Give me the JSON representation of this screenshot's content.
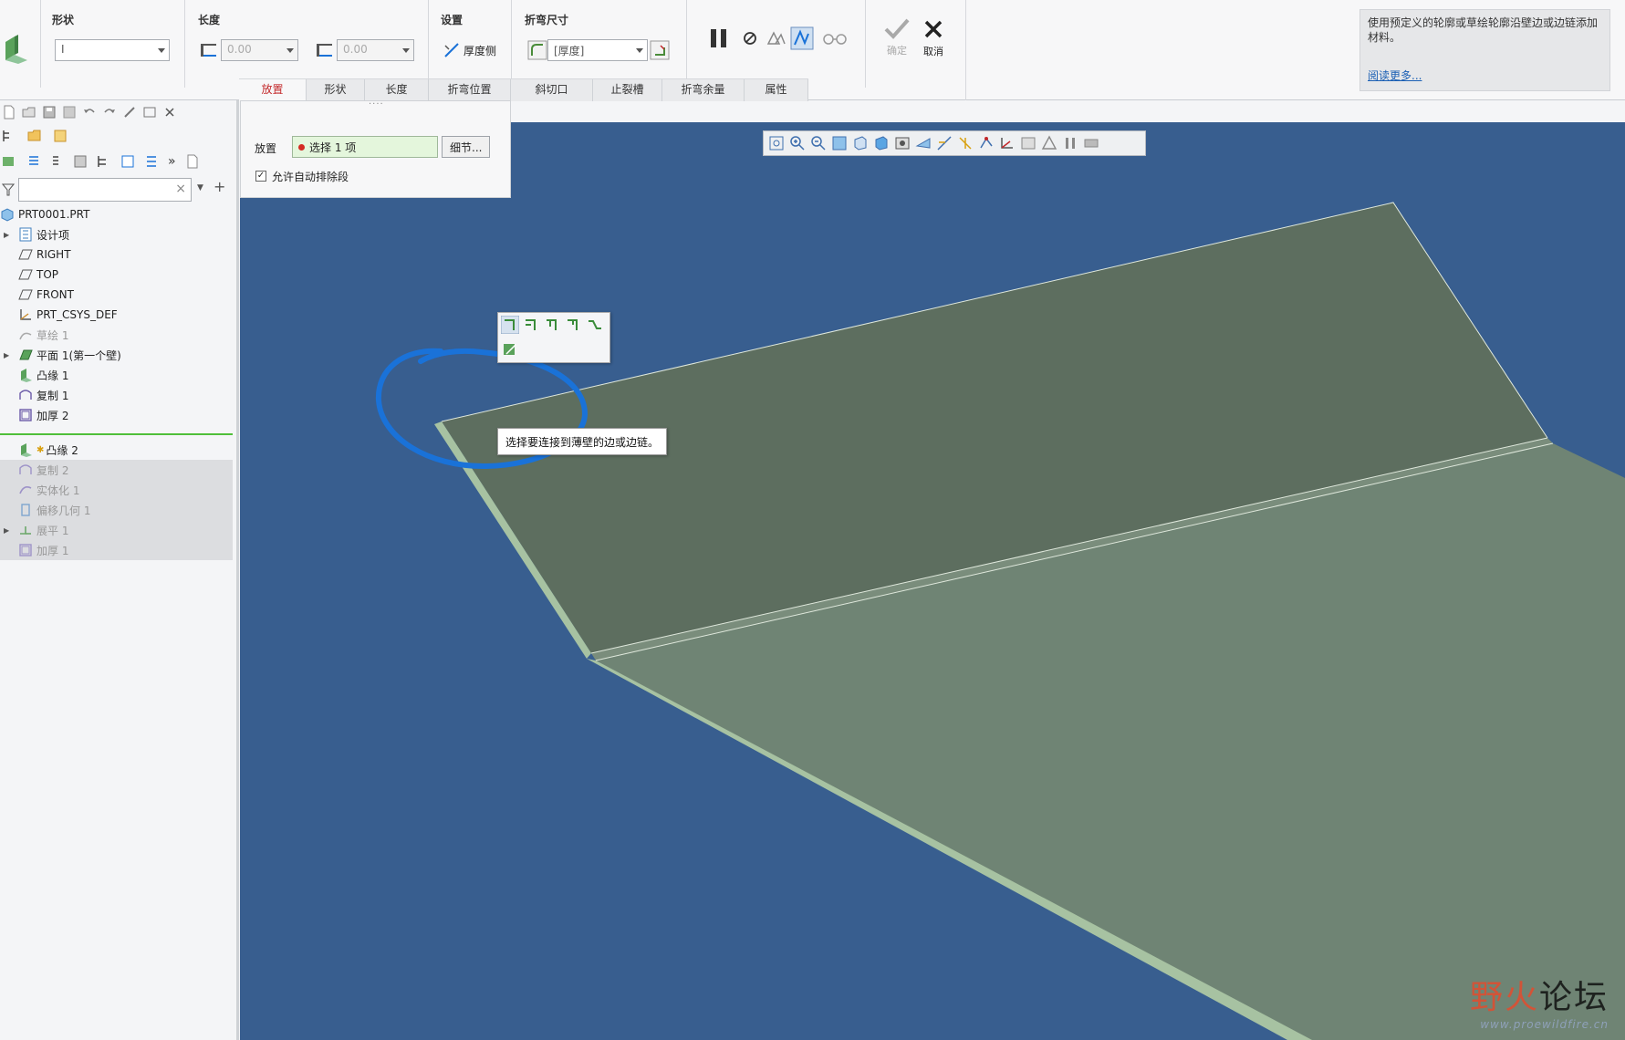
{
  "dashboard": {
    "shape_label": "形状",
    "shape_value": "I",
    "length_label": "长度",
    "length_value1": "0.00",
    "length_value2": "0.00",
    "settings_label": "设置",
    "thickness_side_label": "厚度侧",
    "bend_dim_label": "折弯尺寸",
    "bend_dim_value": "[厚度]",
    "ok_label": "确定",
    "cancel_label": "取消",
    "tabs": [
      "放置",
      "形状",
      "长度",
      "折弯位置",
      "斜切口",
      "止裂槽",
      "折弯余量",
      "属性"
    ],
    "help_text": "使用预定义的轮廓或草绘轮廓沿壁边或边链添加材料。",
    "help_link": "阅读更多..."
  },
  "placement": {
    "label": "放置",
    "selection": "选择 1 项",
    "details_button": "细节...",
    "auto_exclude_label": "允许自动排除段",
    "auto_exclude_checked": true
  },
  "tree": {
    "items": [
      {
        "label": "PRT0001.PRT",
        "icon": "part-icon"
      },
      {
        "label": "设计项",
        "icon": "design-items-icon"
      },
      {
        "label": "RIGHT",
        "icon": "datum-plane-icon"
      },
      {
        "label": "TOP",
        "icon": "datum-plane-icon"
      },
      {
        "label": "FRONT",
        "icon": "datum-plane-icon"
      },
      {
        "label": "PRT_CSYS_DEF",
        "icon": "csys-icon"
      },
      {
        "label": "草绘 1",
        "icon": "sketch-icon"
      },
      {
        "label": "平面 1(第一个壁)",
        "icon": "planar-wall-icon"
      },
      {
        "label": "凸缘 1",
        "icon": "flange-icon"
      },
      {
        "label": "复制 1",
        "icon": "copy-icon"
      },
      {
        "label": "加厚 2",
        "icon": "thicken-icon"
      },
      {
        "label": "凸缘 2",
        "icon": "flange-icon"
      },
      {
        "label": "复制 2",
        "icon": "copy-icon"
      },
      {
        "label": "实体化 1",
        "icon": "solidify-icon"
      },
      {
        "label": "偏移几何 1",
        "icon": "offset-geometry-icon"
      },
      {
        "label": "展平 1",
        "icon": "flatten-icon"
      },
      {
        "label": "加厚 1",
        "icon": "thicken-icon"
      }
    ]
  },
  "viewport": {
    "tooltip": "选择要连接到薄壁的边或边链。"
  },
  "watermark": {
    "title_a": "野火",
    "title_b": "论坛",
    "url": "www.proewildfire.cn"
  },
  "colors": {
    "viewport_bg": "#385e8f",
    "active_tab": "#c3282a",
    "upper_face": "#5d6e5f",
    "lower_face": "#6f8474",
    "edge": "#a7c2a2",
    "annotation_circle": "#1a72d8"
  }
}
